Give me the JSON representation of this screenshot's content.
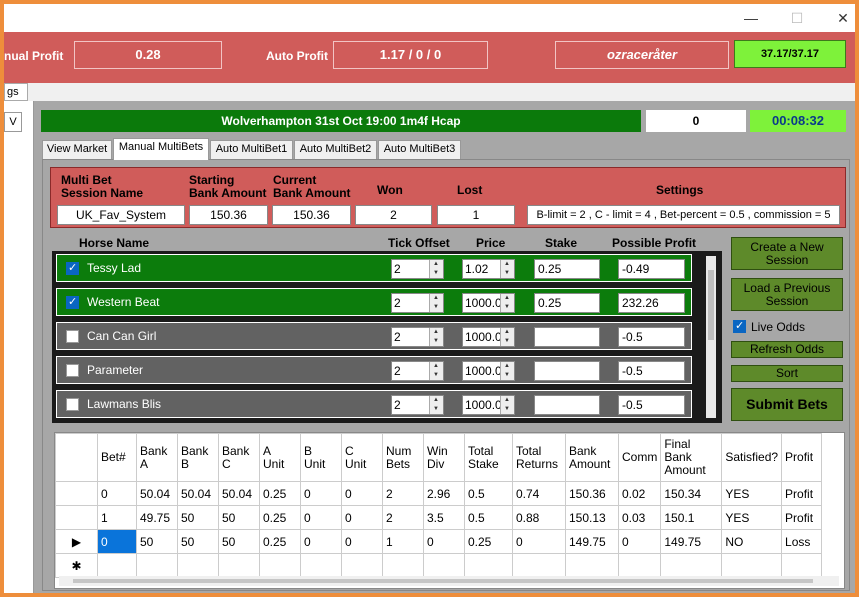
{
  "window": {
    "minimize": "—",
    "maximize": "☐",
    "close": "✕"
  },
  "header": {
    "manual_profit_label": "nual Profit",
    "manual_profit_value": "0.28",
    "auto_profit_label": "Auto Profit",
    "auto_profit_value": "1.17 / 0 / 0",
    "user": "ozraceråter",
    "user_stats": "37.17/37.17"
  },
  "left_tab_stub": "gs",
  "left_pane_stub": "V",
  "race": {
    "title": "Wolverhampton 31st Oct 19:00 1m4f Hcap",
    "count": "0",
    "timer": "00:08:32"
  },
  "tabs": [
    "View Market",
    "Manual MultiBets",
    "Auto MultiBet1",
    "Auto MultiBet2",
    "Auto MultiBet3"
  ],
  "session": {
    "labels": {
      "name": "Multi Bet\nSession Name",
      "starting": "Starting\nBank Amount",
      "current": "Current\nBank Amount",
      "won": "Won",
      "lost": "Lost",
      "settings": "Settings"
    },
    "name": "UK_Fav_System",
    "starting_bank": "150.36",
    "current_bank": "150.36",
    "won": "2",
    "lost": "1",
    "settings": "B-limit = 2 , C - limit = 4 , Bet-percent = 0.5 , commission = 5"
  },
  "horse_header": {
    "name": "Horse Name",
    "tick": "Tick Offset",
    "price": "Price",
    "stake": "Stake",
    "profit": "Possible Profit"
  },
  "horses": [
    {
      "name": "Tessy Lad",
      "checked": true,
      "tick": "2",
      "price": "1.02",
      "stake": "0.25",
      "profit": "-0.49"
    },
    {
      "name": "Western Beat",
      "checked": true,
      "tick": "2",
      "price": "1000.0",
      "stake": "0.25",
      "profit": "232.26"
    },
    {
      "name": "Can Can Girl",
      "checked": false,
      "tick": "2",
      "price": "1000.0",
      "stake": "",
      "profit": "-0.5"
    },
    {
      "name": "Parameter",
      "checked": false,
      "tick": "2",
      "price": "1000.0",
      "stake": "",
      "profit": "-0.5"
    },
    {
      "name": "Lawmans Blis",
      "checked": false,
      "tick": "2",
      "price": "1000.0",
      "stake": "",
      "profit": "-0.5"
    }
  ],
  "buttons": {
    "create": "Create a New\nSession",
    "load": "Load a Previous\nSession",
    "live_odds": "Live Odds",
    "refresh": "Refresh Odds",
    "sort": "Sort",
    "submit": "Submit Bets"
  },
  "grid": {
    "columns": [
      "Bet#",
      "Bank\nA",
      "Bank\nB",
      "Bank\nC",
      "A\nUnit",
      "B\nUnit",
      "C\nUnit",
      "Num\nBets",
      "Win\nDiv",
      "Total\nStake",
      "Total\nReturns",
      "Bank\nAmount",
      "Comm",
      "Final\nBank\nAmount",
      "Satisfied?",
      "Profit"
    ],
    "rows": [
      [
        "0",
        "50.04",
        "50.04",
        "50.04",
        "0.25",
        "0",
        "0",
        "2",
        "2.96",
        "0.5",
        "0.74",
        "150.36",
        "0.02",
        "150.34",
        "YES",
        "Profit"
      ],
      [
        "1",
        "49.75",
        "50",
        "50",
        "0.25",
        "0",
        "0",
        "2",
        "3.5",
        "0.5",
        "0.88",
        "150.13",
        "0.03",
        "150.1",
        "YES",
        "Profit"
      ],
      [
        "0",
        "50",
        "50",
        "50",
        "0.25",
        "0",
        "0",
        "1",
        "0",
        "0.25",
        "0",
        "149.75",
        "0",
        "149.75",
        "NO",
        "Loss"
      ]
    ],
    "current_marker": "▶",
    "new_marker": "✱"
  }
}
